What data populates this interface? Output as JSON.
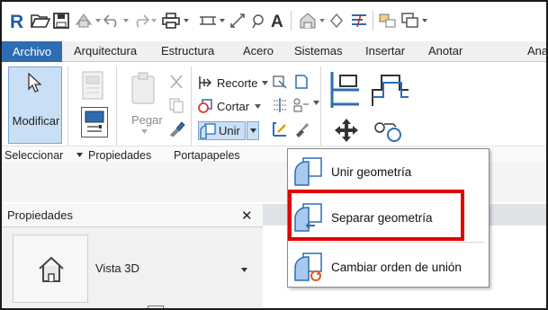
{
  "menu": {
    "tabs": [
      "Archivo",
      "Arquitectura",
      "Estructura",
      "Acero",
      "Sistemas",
      "Insertar",
      "Anotar",
      "Ana"
    ]
  },
  "ribbon": {
    "modify_label": "Modificar",
    "paste_label": "Pegar",
    "recorte_label": "Recorte",
    "cortar_label": "Cortar",
    "unir_label": "Unir",
    "panels": {
      "select": "Seleccionar",
      "properties": "Propiedades",
      "clipboard": "Portapapeles"
    }
  },
  "join_dropdown": {
    "items": [
      "Unir geometría",
      "Separar geometría",
      "Cambiar orden de unión"
    ]
  },
  "properties_panel": {
    "title": "Propiedades",
    "type_name": "Vista 3D"
  },
  "colors": {
    "accent_blue": "#2e6db3",
    "highlight_red": "#e10000",
    "revit_logo_blue": "#1f5ca8"
  }
}
